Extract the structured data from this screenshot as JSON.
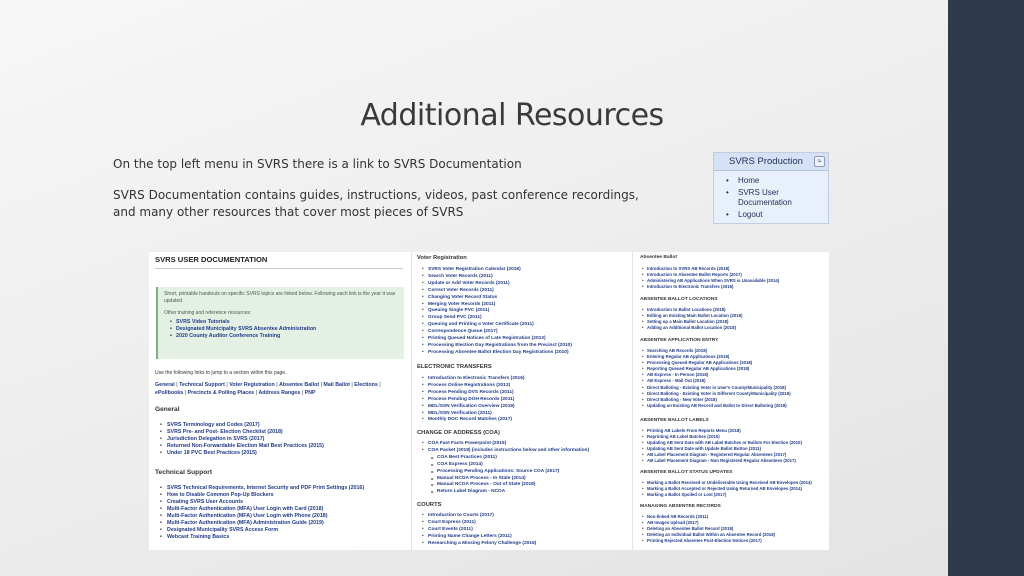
{
  "slide": {
    "title": "Additional Resources",
    "line1": "On the top left menu in SVRS there is a link to SVRS Documentation",
    "line2": "SVRS Documentation contains guides, instructions, videos, past conference recordings, and many other resources that cover most pieces of SVRS"
  },
  "menu": {
    "title": "SVRS Production",
    "toggle": "≈",
    "items": [
      "Home",
      "SVRS User Documentation",
      "Logout"
    ]
  },
  "doc": {
    "title": "SVRS USER DOCUMENTATION",
    "intro": "Short, printable handouts on specific SVRS topics are linked below. Following each link is the year it was updated.",
    "other": "Other training and reference resources:",
    "resources": [
      "SVRS Video Tutorials",
      "Designated Municipality SVRS Absentee Administration",
      "2020 County Auditor Conference Training"
    ],
    "note": "Use the following links to jump to a section within this page.",
    "jump_links": [
      "General",
      "Technical Support",
      "Voter Registration",
      "Absentee Ballot",
      "Mail Ballot",
      "Elections",
      "ePollbooks",
      "Precincts & Polling Places",
      "Address Ranges",
      "PNP"
    ],
    "general": {
      "heading": "General",
      "items": [
        "SVRS Terminology and Codes (2017)",
        "SVRS Pre- and Post- Election Checklist (2018)",
        "Jurisdiction Delegation in SVRS (2017)",
        "Returned Non-Forwardable Election Mail Best Practices (2015)",
        "Under 18 PVC Best Practices (2015)"
      ]
    },
    "tech": {
      "heading": "Technical Support",
      "items": [
        "SVRS Technical Requirements, Internet Security and PDF Print Settings (2016)",
        "How to Disable Common Pop-Up Blockers",
        "Creating SVRS User Accounts",
        "Multi-Factor Authentication (MFA) User Login with Card (2018)",
        "Multi-Factor Authentication (MFA) User Login with Phone (2018)",
        "Multi-Factor Authentication (MFA) Administration Guide (2019)",
        "Designated Municipality SVRS Access Form",
        "Webcast Training Basics"
      ]
    },
    "voter_reg": {
      "heading": "Voter Registration",
      "items": [
        "SVRS Voter Registration Calendar (2018)",
        "Search Voter Records (2011)",
        "Update or Add Voter Records (2011)",
        "Correct Voter Records (2011)",
        "Changing Voter Record Status",
        "Merging Voter Records (2011)",
        "Queuing Single PVC (2011)",
        "Group Send PVC (2011)",
        "Queuing and Printing a Voter Certificate (2011)",
        "Correspondence Queue (2017)",
        "Printing Queued Notices of Late Registration (2013)",
        "Processing Election Day Registrations from the Precinct (2010)",
        "Processing Absentee Ballot Election Day Registrations (2010)"
      ]
    },
    "electronic": {
      "heading": "ELECTRONIC TRANSFERS",
      "items": [
        "Introduction to Electronic Transfers (2016)",
        "Process Online Registrations (2013)",
        "Process Pending DVS Records (2011)",
        "Process Pending DOH Records (2011)",
        "MDL/SSN Verification Overview (2019)",
        "MDL/SSN Verification (2011)",
        "Monthly DOC Record Matches (2017)"
      ]
    },
    "coa": {
      "heading": "CHANGE OF ADDRESS (COA)",
      "items": [
        "COA Fast Facts Powerpoint (2015)",
        "COA Packet (2018) (includes instructions below and other information)"
      ],
      "subitems": [
        "COA Best Practices (2011)",
        "COA Express (2014)",
        "Processing Pending Applications: Source COA (2017)",
        "Manual NCOA Process - In State (2014)",
        "Manual NCOA Process - Out of State (2018)",
        "Return Label Diagram - NCOA"
      ]
    },
    "courts": {
      "heading": "COURTS",
      "items": [
        "Introduction to Courts (2017)",
        "Court Express (2011)",
        "Court Events (2011)",
        "Printing Name Change Letters (2011)",
        "Researching a Missing Felony Challenge (2016)"
      ]
    },
    "absentee": {
      "heading": "Absentee Ballot",
      "items": [
        "Introduction to SVRS AB Records (2018)",
        "Introduction to Absentee Ballot Reports (2017)",
        "Administering AB Applications When SVRS is Unavailable (2014)",
        "Introduction to Electronic Transfers (2016)"
      ]
    },
    "ab_location": {
      "heading": "ABSENTEE BALLOT LOCATIONS",
      "items": [
        "Introduction to Ballot Locations (2018)",
        "Editing an Existing Main Ballot Location (2018)",
        "Setting up a Main Ballot Location (2018)",
        "Adding an Additional Ballot Location (2018)"
      ]
    },
    "ab_app": {
      "heading": "ABSENTEE APPLICATION ENTRY",
      "items": [
        "Searching AB Records (2018)",
        "Entering Regular AB Applications (2018)",
        "Processing Queued Regular AB Applications (2018)",
        "Reporting Queued Regular AB Applications (2018)",
        "AB Express - In Person (2018)",
        "AB Express - Mail Out (2018)",
        "Direct Balloting - Existing Voter in User's County/Municipality (2018)",
        "Direct Balloting - Existing Voter in Different County/Municipality (2018)",
        "Direct Balloting - New Voter (2018)",
        "Updating an Existing AB Record and Ballot to Direct Balloting (2018)"
      ]
    },
    "ab_labels": {
      "heading": "ABSENTEE BALLOT LABELS",
      "items": [
        "Printing AB Labels From Reports Menu (2018)",
        "Reprinting AB Label Batches (2010)",
        "Updating AB Sent Date with AB Label Batches or Ballots For Election (2010)",
        "Updating AB Sent Date with Update Ballot Button (2011)",
        "AB Label Placement Diagram - Registered Regular Absentees (2017)",
        "AB Label Placement Diagram - Non Registered Regular Absentees (2017)"
      ]
    },
    "ab_status": {
      "heading": "ABSENTEE BALLOT STATUS UPDATES",
      "items": [
        "Marking a Ballot Received or Undeliverable Using Received AB Envelopes (2014)",
        "Marking a Ballot Accepted or Rejected Using Returned AB Envelopes (2014)",
        "Marking a Ballot Spoiled or Lost (2017)"
      ]
    },
    "managing": {
      "heading": "MANAGING ABSENTEE RECORDS",
      "items": [
        "Non-linked AB Records (2011)",
        "AB Images Upload (2017)",
        "Deleting an Absentee Ballot Record (2018)",
        "Deleting an Individual Ballot Within an Absentee Record (2018)",
        "Printing Rejected Absentee Post-Election Notices (2017)"
      ]
    }
  }
}
